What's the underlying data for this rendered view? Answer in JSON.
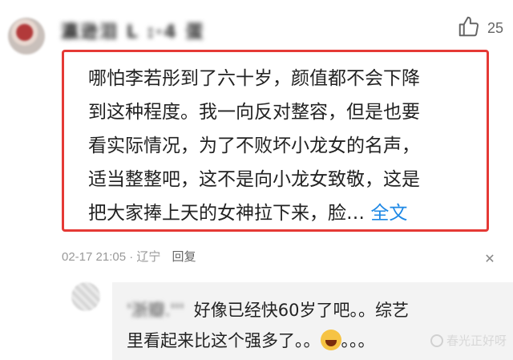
{
  "comment": {
    "username": "瀛逊泪 L :·4 蛋",
    "likes": "25",
    "text_lines": [
      "哪怕李若彤到了六十岁，颜值都不会下降",
      "到这种程度。我一向反对整容，但是也要",
      "看实际情况，为了不败坏小龙女的名声，",
      "适当整整吧，这不是向小龙女致敬，这是",
      "把大家捧上天的女神拉下来，脸…"
    ],
    "full_text_link": "全文",
    "timestamp": "02-17 21:05",
    "location": "辽宁",
    "reply_label": "回复"
  },
  "reply": {
    "username": "'浙瓣.'''",
    "text_line1": "好像已经快60岁了吧。。综艺",
    "text_line2": "里看起来比这个强多了。。",
    "trailing": "。。。"
  },
  "watermark": "春光正好呀",
  "colors": {
    "highlight_border": "#e53935",
    "link": "#1e88e5",
    "meta": "#999999"
  },
  "icons": {
    "like": "thumbs-up-icon",
    "close": "close-icon",
    "emoji": "laughing-tears-emoji"
  }
}
